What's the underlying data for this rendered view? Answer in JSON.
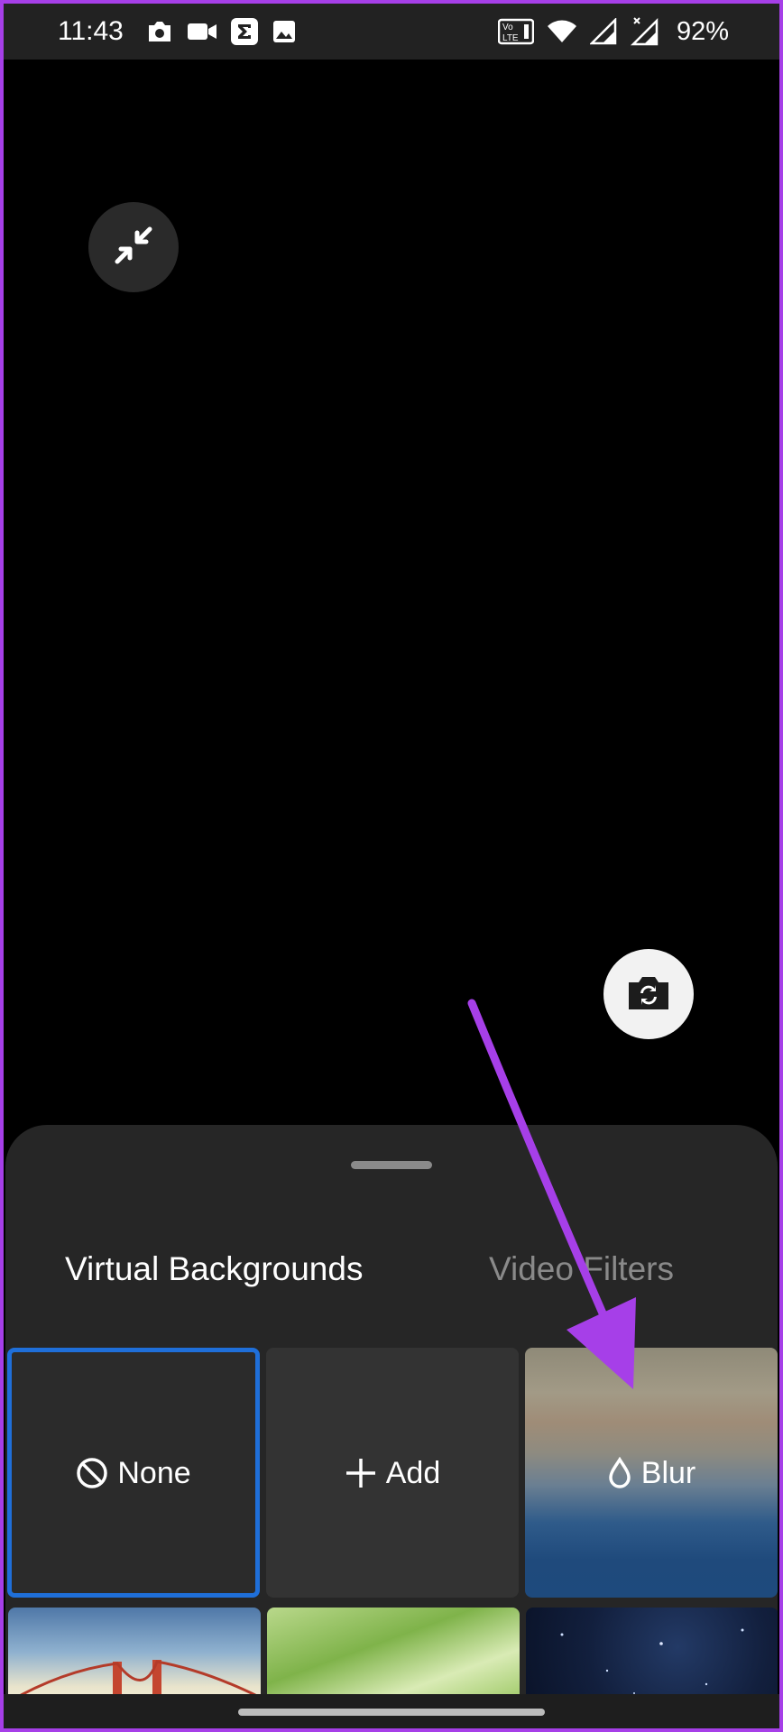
{
  "status_bar": {
    "time": "11:43",
    "battery": "92%",
    "left_icons": [
      "camera-icon",
      "video-camera-icon",
      "sigma-app-icon",
      "image-icon"
    ],
    "right_icons": [
      "volte-icon",
      "wifi-icon",
      "signal-icon",
      "signal-no-data-icon"
    ]
  },
  "preview": {
    "collapse_icon": "collapse-arrows-icon",
    "switch_camera_icon": "switch-camera-icon"
  },
  "sheet": {
    "tabs": [
      {
        "label": "Virtual Backgrounds",
        "active": true
      },
      {
        "label": "Video Filters",
        "active": false
      }
    ],
    "tiles": [
      {
        "label": "None",
        "icon": "none-icon",
        "selected": true
      },
      {
        "label": "Add",
        "icon": "plus-icon",
        "selected": false
      },
      {
        "label": "Blur",
        "icon": "droplet-icon",
        "selected": false
      }
    ],
    "thumbnails": [
      "golden-gate-bridge",
      "green-grass",
      "starry-sky"
    ]
  },
  "colors": {
    "selection_border": "#1f6fd9",
    "annotation_arrow": "#a63fe8",
    "sheet_background": "#262626"
  }
}
